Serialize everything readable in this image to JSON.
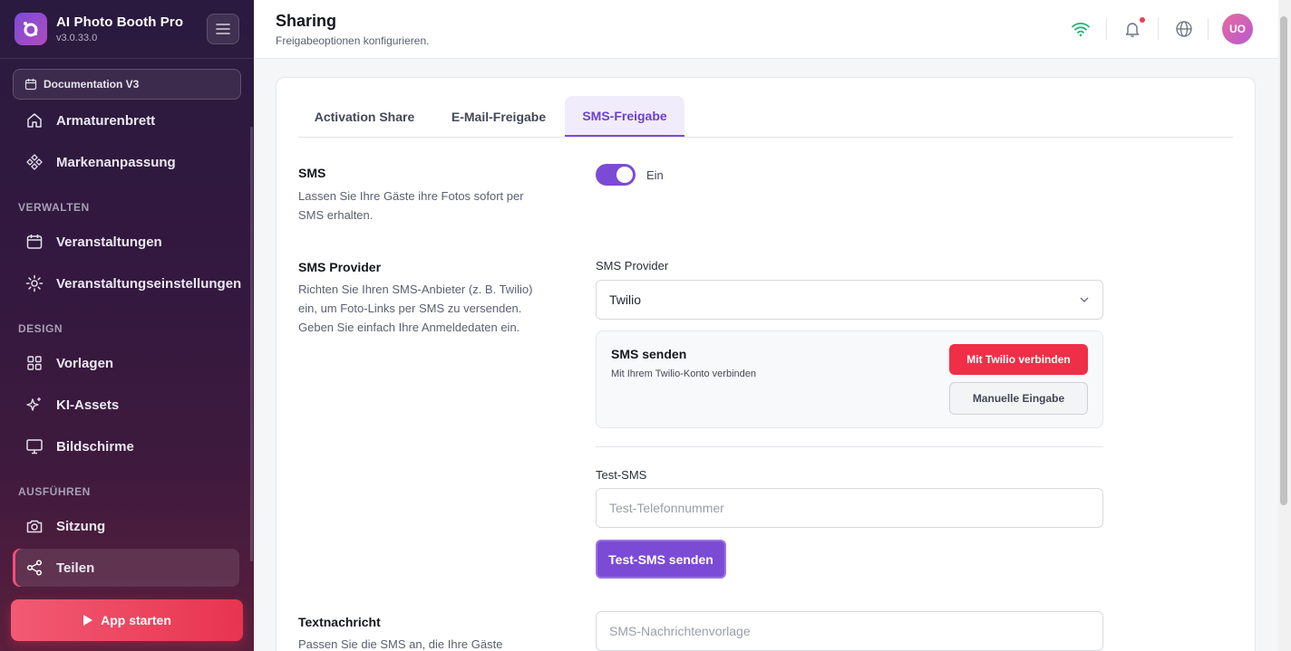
{
  "app": {
    "name": "AI Photo Booth Pro",
    "version": "v3.0.33.0"
  },
  "sidebar": {
    "doc_button": "Documentation V3",
    "items_top": [
      {
        "label": "Armaturenbrett",
        "icon": "home-icon"
      },
      {
        "label": "Markenanpassung",
        "icon": "palette-icon"
      }
    ],
    "section_manage": "VERWALTEN",
    "items_manage": [
      {
        "label": "Veranstaltungen",
        "icon": "calendar-icon"
      },
      {
        "label": "Veranstaltungseinstellungen",
        "icon": "gear-icon"
      }
    ],
    "section_design": "DESIGN",
    "items_design": [
      {
        "label": "Vorlagen",
        "icon": "grid-icon"
      },
      {
        "label": "KI-Assets",
        "icon": "sparkles-icon"
      },
      {
        "label": "Bildschirme",
        "icon": "monitor-icon"
      }
    ],
    "section_run": "AUSFÜHREN",
    "items_run": [
      {
        "label": "Sitzung",
        "icon": "camera-icon"
      },
      {
        "label": "Teilen",
        "icon": "share-icon",
        "active": true
      }
    ],
    "start_button": "App starten"
  },
  "header": {
    "title": "Sharing",
    "subtitle": "Freigabeoptionen konfigurieren.",
    "avatar_initials": "UO"
  },
  "tabs": [
    {
      "label": "Activation Share"
    },
    {
      "label": "E-Mail-Freigabe"
    },
    {
      "label": "SMS-Freigabe",
      "active": true
    }
  ],
  "sms": {
    "title": "SMS",
    "description": "Lassen Sie Ihre Gäste ihre Fotos sofort per SMS erhalten.",
    "toggle_label": "Ein",
    "enabled": true
  },
  "provider": {
    "title": "SMS Provider",
    "description": "Richten Sie Ihren SMS-Anbieter (z. B. Twilio) ein, um Foto-Links per SMS zu versenden. Geben Sie einfach Ihre Anmeldedaten ein.",
    "field_label": "SMS Provider",
    "selected": "Twilio",
    "connect_title": "SMS senden",
    "connect_sub": "Mit Ihrem Twilio-Konto verbinden",
    "connect_button": "Mit Twilio verbinden",
    "manual_button": "Manuelle Eingabe"
  },
  "test": {
    "label": "Test-SMS",
    "placeholder": "Test-Telefonnummer",
    "button": "Test-SMS senden"
  },
  "message": {
    "title": "Textnachricht",
    "description": "Passen Sie die SMS an, die Ihre Gäste",
    "placeholder": "SMS-Nachrichtenvorlage"
  },
  "colors": {
    "accent": "#7c4bd6",
    "danger": "#ef2f48",
    "wifi": "#22b573"
  }
}
